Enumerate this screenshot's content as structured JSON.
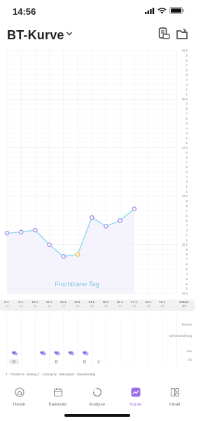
{
  "status": {
    "time": "14:56"
  },
  "header": {
    "title": "BT-Kurve"
  },
  "chart_data": {
    "type": "line",
    "categories": [
      "8.1.",
      "9.1.",
      "10.1.",
      "11.1.",
      "12.1.",
      "13.1.",
      "14.1.",
      "15.1.",
      "16.1.",
      "17.1.",
      "18.1.",
      "19.1."
    ],
    "day_numbers": [
      "13",
      "14",
      "15",
      "16",
      "17",
      "18",
      "19",
      "20",
      "21",
      "22",
      "23",
      "24"
    ],
    "series": [
      {
        "values": [
          36.62,
          36.63,
          36.65,
          36.5,
          36.38,
          36.4,
          36.78,
          36.69,
          36.75,
          36.87
        ]
      }
    ],
    "highlight_index": 5,
    "annotation": "Fruchtbarer Tag",
    "ylim": [
      36.0,
      38.5
    ],
    "y_ticks": [
      "38.5",
      ".9",
      ".8",
      ".7",
      ".6",
      ".5",
      ".4",
      ".3",
      ".2",
      ".1",
      "38.0",
      ".9",
      ".8",
      ".7",
      ".6",
      ".5",
      ".4",
      ".3",
      ".2",
      ".1",
      "37.5",
      ".9",
      ".8",
      ".7",
      ".6",
      ".5",
      ".4",
      ".3",
      ".2",
      ".1",
      "37.0",
      ".9",
      ".8",
      ".7",
      ".6",
      ".5",
      ".4",
      ".3",
      ".2",
      ".1",
      "36.5",
      ".9",
      ".8",
      ".7",
      ".6",
      ".5",
      ".4",
      ".3",
      ".2",
      ".1",
      "36.0"
    ],
    "line_color": "#8ddcea",
    "point_color": "#a689e8",
    "highlight_color": "#f5c242",
    "fill_color": "#f3f0fb"
  },
  "datebar": {
    "label": "Datum",
    "day_label": "27"
  },
  "lower": {
    "row_labels": [
      "Periode",
      "Schmerzwahrung",
      "Sex",
      "ZS"
    ],
    "markers": [
      {
        "col": 0,
        "text": "Ei"
      },
      {
        "col": 3,
        "text": "Ei"
      },
      {
        "col": 5,
        "text": "Ei"
      },
      {
        "col": 6,
        "text": "C"
      }
    ]
  },
  "legend": "T - Trocken  K - klebrig  C - Cremig  W - Wässrig  Ei - Eiweißmäßig",
  "tabs": [
    {
      "label": "Heute",
      "icon": "home-icon"
    },
    {
      "label": "Kalender",
      "icon": "calendar-icon"
    },
    {
      "label": "Analyse",
      "icon": "analysis-icon"
    },
    {
      "label": "Kurve",
      "icon": "curve-icon"
    },
    {
      "label": "Inhalt",
      "icon": "content-icon"
    }
  ],
  "active_tab": "Kurve"
}
